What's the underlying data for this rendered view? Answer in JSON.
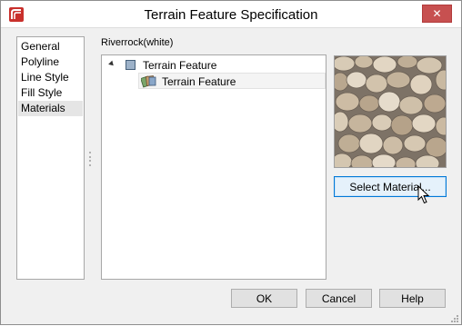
{
  "window": {
    "title": "Terrain Feature Specification",
    "close_label": "✕"
  },
  "nav": {
    "items": [
      {
        "label": "General"
      },
      {
        "label": "Polyline"
      },
      {
        "label": "Line Style"
      },
      {
        "label": "Fill Style"
      },
      {
        "label": "Materials"
      }
    ],
    "selected": "Materials"
  },
  "material": {
    "name": "Riverrock(white)"
  },
  "tree": {
    "root_label": "Terrain Feature",
    "child_label": "Terrain Feature"
  },
  "buttons": {
    "select_material": "Select Material...",
    "ok": "OK",
    "cancel": "Cancel",
    "help": "Help"
  },
  "colors": {
    "accent": "#0078d7",
    "close": "#c75050",
    "app_icon": "#c9302c"
  }
}
